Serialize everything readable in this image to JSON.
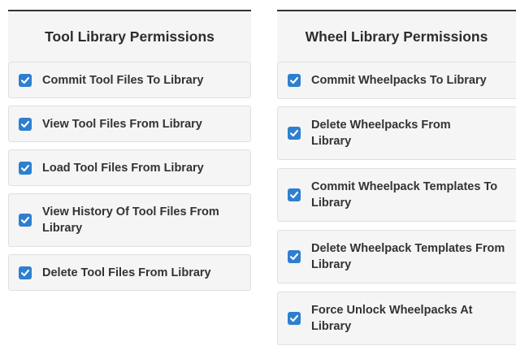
{
  "tool_library": {
    "title": "Tool Library Permissions",
    "items": [
      {
        "label": "Commit Tool Files To Library",
        "checked": true
      },
      {
        "label": "View Tool Files From Library",
        "checked": true
      },
      {
        "label": "Load Tool Files From Library",
        "checked": true
      },
      {
        "label": "View History Of Tool Files From Library",
        "checked": true
      },
      {
        "label": "Delete Tool Files From Library",
        "checked": true
      }
    ]
  },
  "wheel_library": {
    "title": "Wheel Library Permissions",
    "items": [
      {
        "label": "Commit Wheelpacks To Library",
        "checked": true
      },
      {
        "label": "Delete Wheelpacks From Library",
        "checked": true
      },
      {
        "label": "Commit Wheelpack Templates To Library",
        "checked": true
      },
      {
        "label": "Delete Wheelpack Templates From Library",
        "checked": true
      },
      {
        "label": "Force Unlock Wheelpacks At Library",
        "checked": true
      }
    ]
  },
  "colors": {
    "checkbox": "#2f7fd0",
    "panel_bg": "#f5f5f5"
  },
  "icons": {
    "checkbox_checked": "checkmark-icon"
  }
}
